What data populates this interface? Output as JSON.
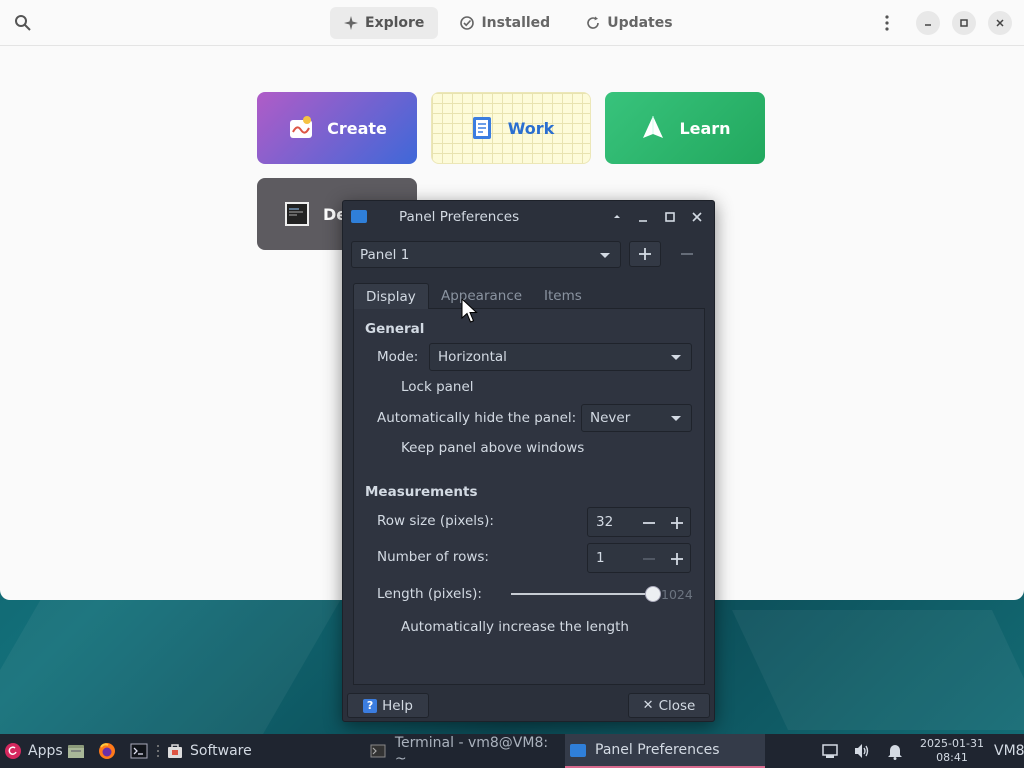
{
  "software": {
    "tabs": [
      {
        "label": "Explore",
        "icon": "sparkle-icon"
      },
      {
        "label": "Installed",
        "icon": "check-circle-icon"
      },
      {
        "label": "Updates",
        "icon": "refresh-icon"
      }
    ],
    "tiles": [
      {
        "label": "Create"
      },
      {
        "label": "Work"
      },
      {
        "label": "Learn"
      },
      {
        "label": "De"
      }
    ]
  },
  "dialog": {
    "title": "Panel Preferences",
    "panel_select": "Panel 1",
    "tabs": [
      "Display",
      "Appearance",
      "Items"
    ],
    "general": {
      "header": "General",
      "mode_label": "Mode:",
      "mode_value": "Horizontal",
      "lock_panel": "Lock panel",
      "autohide_label": "Automatically hide the panel:",
      "autohide_value": "Never",
      "keep_above": "Keep panel above windows"
    },
    "measurements": {
      "header": "Measurements",
      "row_size_label": "Row size (pixels):",
      "row_size_value": "32",
      "rows_label": "Number of rows:",
      "rows_value": "1",
      "length_label": "Length (pixels):",
      "length_value": "1024",
      "auto_increase": "Automatically increase the length"
    },
    "help_label": "Help",
    "close_label": "Close"
  },
  "taskbar": {
    "apps_label": "Apps",
    "software_label": "Software",
    "tasks": [
      {
        "label": "Terminal - vm8@VM8: ~",
        "active": false
      },
      {
        "label": "Panel Preferences",
        "active": true
      }
    ],
    "date": "2025-01-31",
    "time": "08:41",
    "user": "VM8"
  }
}
